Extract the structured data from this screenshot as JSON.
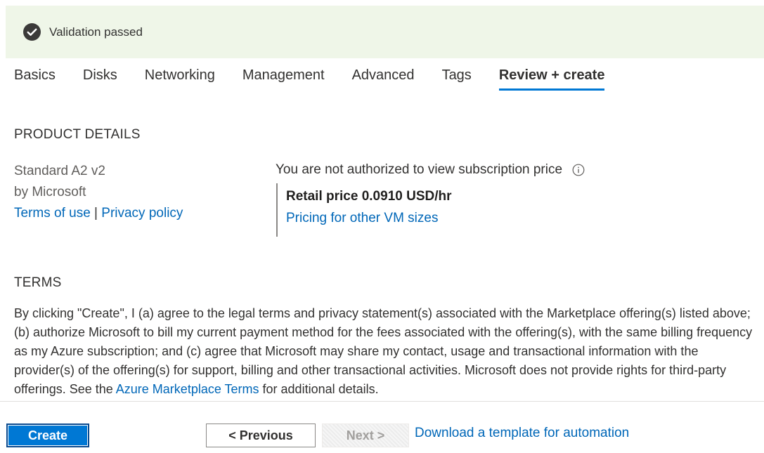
{
  "banner": {
    "message": "Validation passed",
    "icon": "check-circle-icon",
    "color": "#eff6e8"
  },
  "tabs": [
    {
      "label": "Basics"
    },
    {
      "label": "Disks"
    },
    {
      "label": "Networking"
    },
    {
      "label": "Management"
    },
    {
      "label": "Advanced"
    },
    {
      "label": "Tags"
    },
    {
      "label": "Review + create",
      "active": true
    }
  ],
  "product_details": {
    "heading": "PRODUCT DETAILS",
    "name": "Standard A2 v2",
    "publisher": "by Microsoft",
    "terms_link": "Terms of use",
    "separator": "|",
    "privacy_link": "Privacy policy",
    "auth_message": "You are not authorized to view subscription price",
    "info_icon": "info-icon",
    "retail_price": "Retail price 0.0910 USD/hr",
    "pricing_link": "Pricing for other VM sizes"
  },
  "terms": {
    "heading": "TERMS",
    "body_before": "By clicking \"Create\", I (a) agree to the legal terms and privacy statement(s) associated with the Marketplace offering(s) listed above; (b) authorize Microsoft to bill my current payment method for the fees associated with the offering(s), with the same billing frequency as my Azure subscription; and (c) agree that Microsoft may share my contact, usage and transactional information with the provider(s) of the offering(s) for support, billing and other transactional activities. Microsoft does not provide rights for third-party offerings. See the ",
    "link": "Azure Marketplace Terms",
    "body_after": " for additional details."
  },
  "footer": {
    "create_label": "Create",
    "previous_label": "< Previous",
    "next_label": "Next >",
    "download_link": "Download a template for automation"
  },
  "colors": {
    "accent": "#0078d4",
    "link": "#0067b8",
    "success": "#3b3a39"
  }
}
